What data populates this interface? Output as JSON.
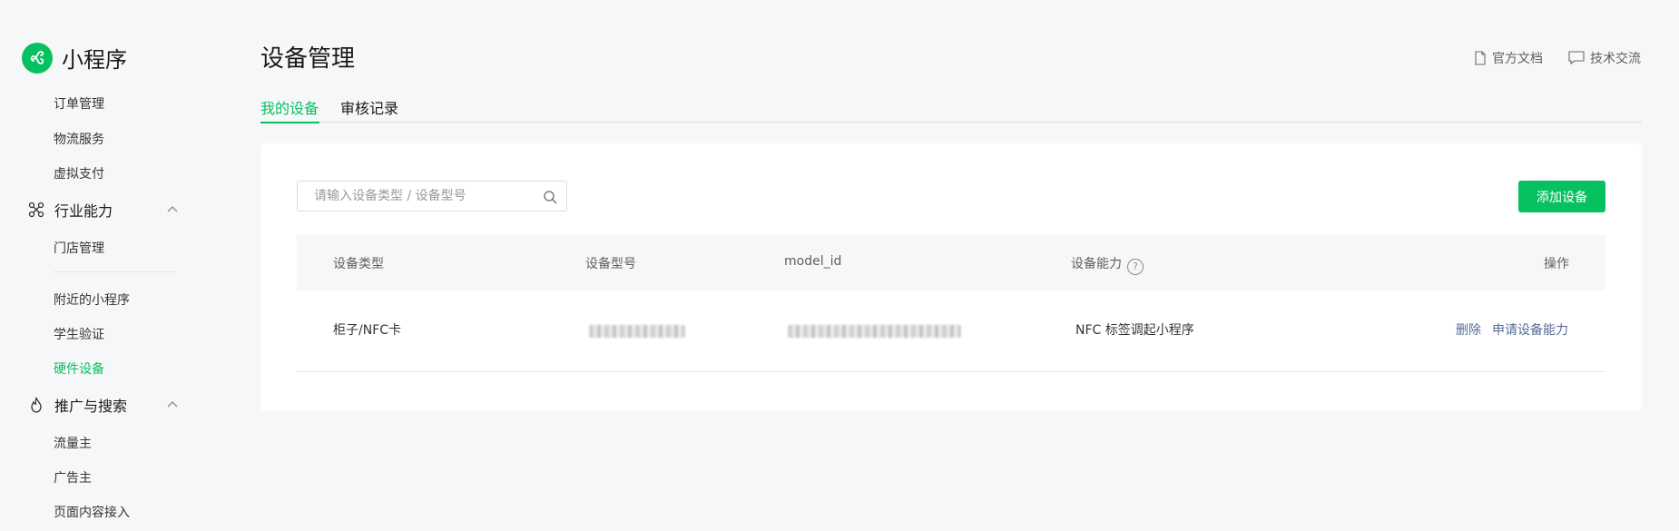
{
  "app": {
    "name": "小程序",
    "brand_color": "#07c160",
    "logo_icon": "miniprogram-logo-icon"
  },
  "sidebar": {
    "items_top": [
      {
        "label": "订单管理"
      },
      {
        "label": "物流服务"
      },
      {
        "label": "虚拟支付"
      }
    ],
    "group_industry": {
      "label": "行业能力",
      "icon": "industry-icon",
      "expanded": true
    },
    "items_industry": [
      {
        "label": "门店管理"
      }
    ],
    "items_misc": [
      {
        "label": "附近的小程序"
      },
      {
        "label": "学生验证"
      },
      {
        "label": "硬件设备",
        "active": true
      }
    ],
    "group_promo": {
      "label": "推广与搜索",
      "icon": "flame-icon",
      "expanded": true
    },
    "items_promo": [
      {
        "label": "流量主"
      },
      {
        "label": "广告主"
      },
      {
        "label": "页面内容接入"
      }
    ]
  },
  "header": {
    "title": "设备管理",
    "links": [
      {
        "label": "官方文档",
        "icon": "document-icon"
      },
      {
        "label": "技术交流",
        "icon": "chat-icon"
      }
    ]
  },
  "tabs": [
    {
      "label": "我的设备",
      "active": true
    },
    {
      "label": "审核记录",
      "active": false
    }
  ],
  "toolbar": {
    "search_placeholder": "请输入设备类型 / 设备型号",
    "add_button": "添加设备"
  },
  "table": {
    "columns": [
      "设备类型",
      "设备型号",
      "model_id",
      "设备能力",
      "操作"
    ],
    "rows": [
      {
        "device_type": "柜子/NFC卡",
        "device_model": "",
        "model_id": "",
        "capability": "NFC 标签调起小程序",
        "actions": [
          "删除",
          "申请设备能力"
        ]
      }
    ]
  }
}
